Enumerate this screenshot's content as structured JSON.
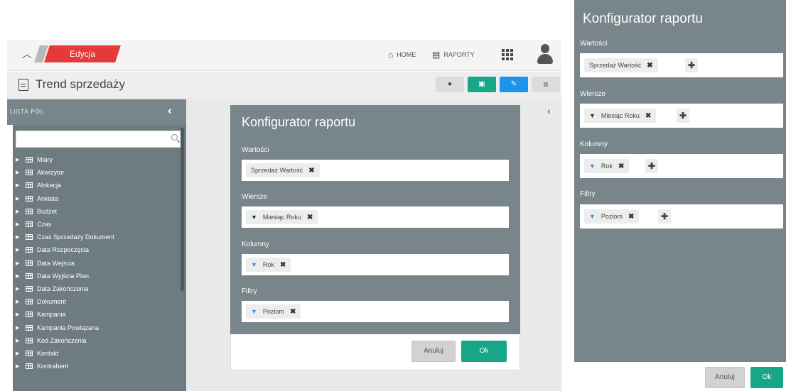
{
  "topbar": {
    "edit_tab": "Edycja",
    "home": "HOME",
    "reports": "RAPORTY"
  },
  "report": {
    "title": "Trend sprzedaży"
  },
  "sidebar": {
    "title": "LISTA PÓL",
    "search_placeholder": "",
    "items": [
      "Miary",
      "Akwizytor",
      "Alokacja",
      "Ankieta",
      "Budżet",
      "Czas",
      "Czas Sprzedaży Dokument",
      "Data Rozpoczęcia",
      "Data Wejścia",
      "Data Wyjścia Plan",
      "Data Zakończenia",
      "Dokument",
      "Kampania",
      "Kampania Powiązana",
      "Kod Zakończenia",
      "Kontakt",
      "Kontrahent"
    ]
  },
  "modal": {
    "title": "Konfigurator raportu",
    "values_label": "Wartości",
    "values_chip": "Sprzedaż Wartość",
    "rows_label": "Wiersze",
    "rows_chip": "Miesiąc Roku",
    "columns_label": "Kolumny",
    "columns_chip": "Rok",
    "filters_label": "Filtry",
    "filters_chip": "Poziom",
    "cancel": "Anuluj",
    "ok": "Ok"
  },
  "panel": {
    "title": "Konfigurator raportu",
    "values_label": "Wartości",
    "values_chip": "Sprzedaż Wartość",
    "rows_label": "Wiersze",
    "rows_chip": "Miesiąc Roku",
    "columns_label": "Kolumny",
    "columns_chip": "Rok",
    "filters_label": "Filtry",
    "filters_chip": "Poziom",
    "cancel": "Anuluj",
    "ok": "Ok"
  },
  "colors": {
    "accent_red": "#e6393a",
    "accent_green": "#18a689",
    "accent_blue": "#1c95e8",
    "panel_gray": "#78858a"
  }
}
